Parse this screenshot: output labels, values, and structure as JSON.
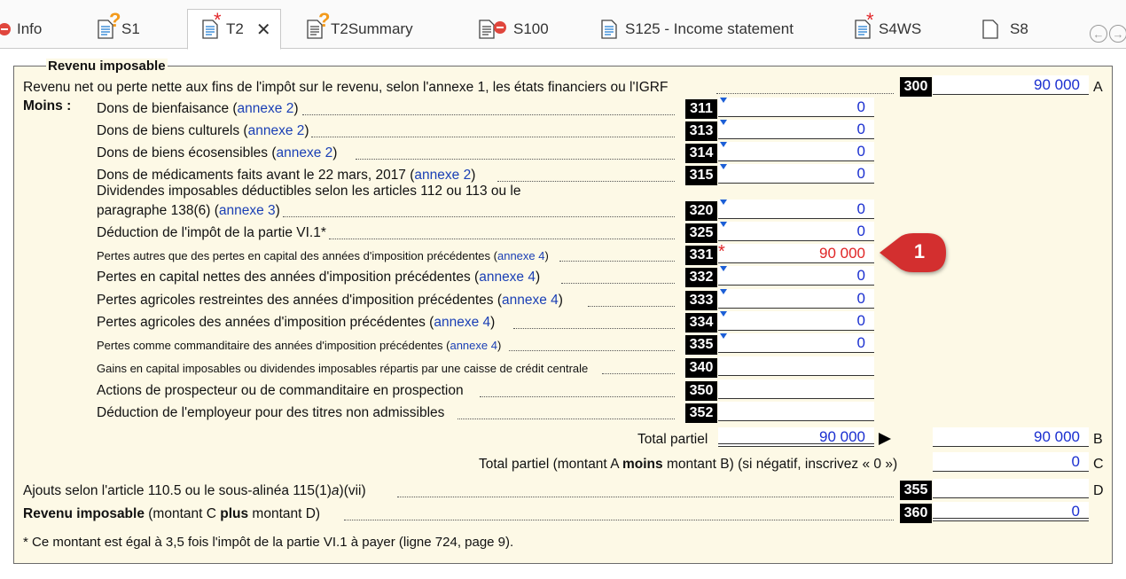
{
  "tabs": [
    {
      "label": "Info",
      "icon": "error-circle-icon",
      "active": false
    },
    {
      "label": "S1",
      "icon": "document-question-icon",
      "active": false
    },
    {
      "label": "T2",
      "icon": "document-star-icon",
      "active": true
    },
    {
      "label": "T2Summary",
      "icon": "document-question-icon",
      "active": false
    },
    {
      "label": "S100",
      "icon": "document-error-icon",
      "active": false
    },
    {
      "label": "S125 - Income statement",
      "icon": "document-icon",
      "active": false
    },
    {
      "label": "S4WS",
      "icon": "document-star-icon",
      "active": false
    },
    {
      "label": "S8",
      "icon": "blank-page-icon",
      "active": false
    }
  ],
  "tab_close": "✕",
  "nav": {
    "prev": "←",
    "next": "→"
  },
  "section_title": "Revenu imposable",
  "line300": {
    "label": "Revenu net ou perte nette aux fins de l'impôt sur le revenu, selon l'annexe 1, les états financiers ou l'IGRF",
    "code": "300",
    "value": "90 000",
    "letter": "A"
  },
  "moins_label": "Moins :",
  "deductions": [
    {
      "text": "Dons de bienfaisance (",
      "link": "annexe 2",
      "tail": ")",
      "code": "311",
      "value": "0"
    },
    {
      "text": "Dons de biens culturels (",
      "link": "annexe 2",
      "tail": ")",
      "code": "313",
      "value": "0"
    },
    {
      "text": "Dons de biens écosensibles (",
      "link": "annexe 2",
      "tail": ")",
      "code": "314",
      "value": "0"
    },
    {
      "text": "Dons de médicaments faits avant le 22 mars, 2017 (",
      "link": "annexe 2",
      "tail": ")",
      "code": "315",
      "value": "0"
    },
    {
      "text1": "Dividendes imposables déductibles selon les articles 112 ou 113 ou le",
      "text": "paragraphe 138(6) (",
      "link": "annexe 3",
      "tail": ")",
      "code": "320",
      "value": "0"
    },
    {
      "text": "Déduction de l'impôt de la partie VI.1*",
      "code": "325",
      "value": "0"
    },
    {
      "text": "Pertes autres que des pertes en capital des années d'imposition précédentes (",
      "link": "annexe 4",
      "tail": ")",
      "code": "331",
      "value": "90 000"
    },
    {
      "text": "Pertes en capital nettes des années d'imposition précédentes (",
      "link": "annexe 4",
      "tail": ")",
      "code": "332",
      "value": "0"
    },
    {
      "text": "Pertes agricoles restreintes des années d'imposition précédentes (",
      "link": "annexe 4",
      "tail": ")",
      "code": "333",
      "value": "0"
    },
    {
      "text": "Pertes agricoles des années d'imposition précédentes (",
      "link": "annexe 4",
      "tail": ")",
      "code": "334",
      "value": "0"
    },
    {
      "text": "Pertes comme commanditaire des années d'imposition précédentes (",
      "link": "annexe 4",
      "tail": ")",
      "code": "335",
      "value": "0"
    },
    {
      "text": "Gains en capital imposables ou dividendes imposables répartis par une caisse de crédit centrale",
      "code": "340",
      "value": ""
    },
    {
      "text": "Actions de prospecteur ou de commanditaire en prospection",
      "code": "350",
      "value": ""
    },
    {
      "text": "Déduction de l'employeur pour des titres non admissibles",
      "code": "352",
      "value": ""
    }
  ],
  "total_partiel": {
    "label": "Total partiel",
    "value_left": "90 000",
    "value_right": "90 000",
    "letter": "B"
  },
  "line_c": {
    "pre": "Total partiel (montant A ",
    "bold": "moins",
    "post": " montant B) (si négatif, inscrivez « 0 »)",
    "value": "0",
    "letter": "C"
  },
  "line355": {
    "pre": "Ajouts selon l'article 110.5 ou le sous-alinéa 115(1)",
    "italic": "a",
    "post": ")(vii)",
    "code": "355",
    "value": "",
    "letter": "D"
  },
  "line360": {
    "bold1": "Revenu imposable",
    "pre": " (montant C ",
    "bold2": "plus",
    "post": " montant D)",
    "code": "360",
    "value": "0"
  },
  "footnote": "* Ce montant est égal à 3,5 fois l'impôt de la partie VI.1 à payer (ligne 724, page 9).",
  "callout_number": "1",
  "colors": {
    "link": "#1a3fb5",
    "value_blue": "#1a2fd0",
    "value_red": "#e02525",
    "form_bg": "#fdf9e6",
    "callout": "#d32f2f"
  }
}
